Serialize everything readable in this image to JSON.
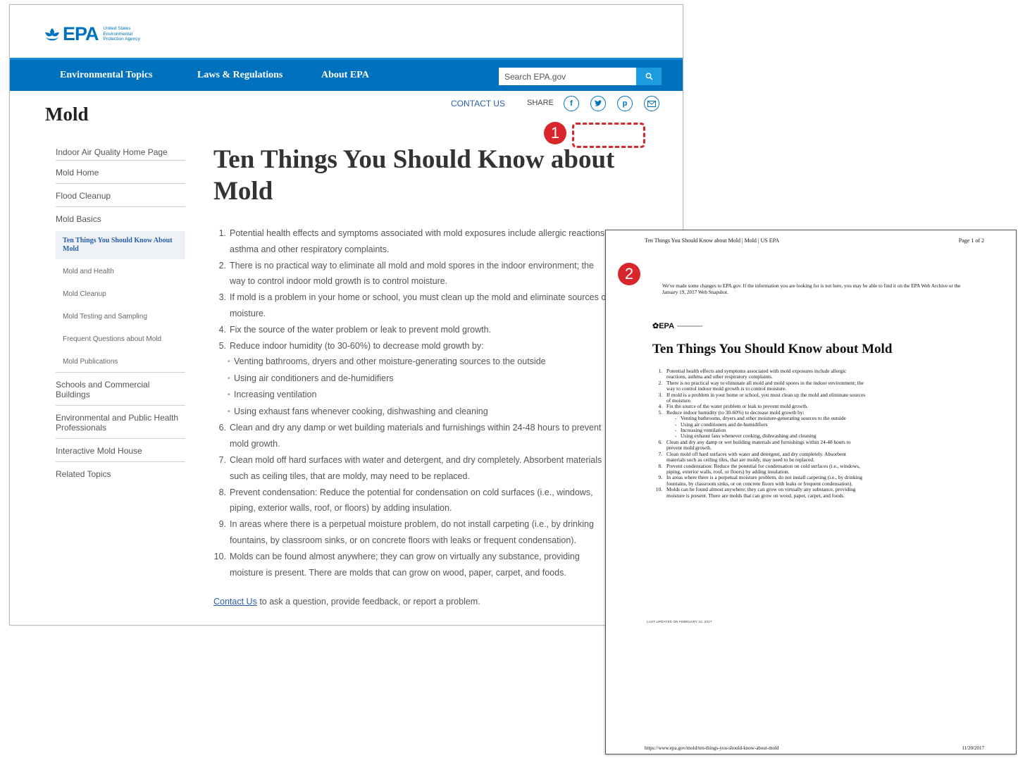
{
  "header": {
    "logo_text": "EPA",
    "agency_name": "United States Environmental Protection Agency"
  },
  "nav": {
    "items": [
      "Environmental Topics",
      "Laws & Regulations",
      "About EPA"
    ],
    "search_placeholder": "Search EPA.gov"
  },
  "utility": {
    "contact": "CONTACT US",
    "share": "SHARE"
  },
  "page_title": "Mold",
  "sidebar": {
    "items": [
      "Indoor Air Quality Home Page",
      "Mold Home",
      "Flood Cleanup",
      "Mold Basics"
    ],
    "subitems": [
      "Ten Things You Should Know About Mold",
      "Mold and Health",
      "Mold Cleanup",
      "Mold Testing and Sampling",
      "Frequent Questions about Mold",
      "Mold Publications"
    ],
    "items_after": [
      "Schools and Commercial Buildings",
      "Environmental and Public Health Professionals",
      "Interactive Mold House",
      "Related Topics"
    ]
  },
  "article": {
    "title": "Ten Things You Should Know about Mold",
    "lines": [
      {
        "n": "1.",
        "t": "Potential health effects and symptoms associated with mold exposures include allergic reactions,"
      },
      {
        "n": "",
        "t": "asthma and other respiratory complaints."
      },
      {
        "n": "2.",
        "t": "There is no practical way to eliminate all mold and mold spores in the indoor environment; the"
      },
      {
        "n": "",
        "t": "way to control indoor mold growth is to control moisture."
      },
      {
        "n": "3.",
        "t": "If mold is a problem in your home or school, you must clean up the mold and eliminate sources of"
      },
      {
        "n": "",
        "t": "moisture."
      },
      {
        "n": "4.",
        "t": "Fix the source of the water problem or leak to prevent mold growth."
      },
      {
        "n": "5.",
        "t": "Reduce indoor humidity (to 30-60%) to decrease mold growth by:"
      }
    ],
    "bullets": [
      "Venting bathrooms, dryers and other moisture-generating sources to the outside",
      "Using air conditioners and de-humidifiers",
      "Increasing ventilation",
      "Using exhaust fans whenever cooking, dishwashing and cleaning"
    ],
    "lines2": [
      {
        "n": "6.",
        "t": "Clean and dry any damp or wet building materials and furnishings within 24-48 hours to prevent"
      },
      {
        "n": "",
        "t": "mold growth."
      },
      {
        "n": "7.",
        "t": "Clean mold off hard surfaces with water and detergent, and dry completely. Absorbent materials"
      },
      {
        "n": "",
        "t": "such as ceiling tiles, that are moldy, may need to be replaced."
      },
      {
        "n": "8.",
        "t": "Prevent condensation: Reduce the potential for condensation on cold surfaces (i.e., windows,"
      },
      {
        "n": "",
        "t": "piping, exterior walls, roof, or floors) by adding insulation."
      },
      {
        "n": "9.",
        "t": "In areas where there is a perpetual moisture problem, do not install carpeting (i.e., by drinking"
      },
      {
        "n": "",
        "t": "fountains, by classroom sinks, or on concrete floors with leaks or frequent condensation)."
      },
      {
        "n": "10.",
        "t": "Molds can be found almost anywhere; they can grow on virtually any substance, providing"
      },
      {
        "n": "",
        "t": "moisture is present. There are molds that can grow on wood, paper, carpet, and foods."
      }
    ],
    "contact_link": "Contact Us",
    "contact_rest": " to ask a question, provide feedback, or report a problem."
  },
  "callouts": [
    "1",
    "2"
  ],
  "colors": {
    "epa_blue": "#0071bc",
    "callout_red": "#d9262c",
    "link_blue": "#2b5ea8"
  },
  "print": {
    "header_title": "Ten Things You Should Know about Mold | Mold | US EPA",
    "page_no": "Page 1 of 2",
    "notice": "We've made some changes to EPA.gov. If the information you are looking for is not here, you may be able to find it on the EPA Web Archive or the January 19, 2017 Web Snapshot.",
    "logo_text": "EPA",
    "title": "Ten Things You Should Know about Mold",
    "lines": [
      {
        "n": "1.",
        "t": "Potential health effects and symptoms associated with mold exposures include allergic"
      },
      {
        "n": "",
        "t": "reactions, asthma and other respiratory complaints."
      },
      {
        "n": "2.",
        "t": "There is no practical way to eliminate all mold and mold spores in the indoor environment; the"
      },
      {
        "n": "",
        "t": "way to control indoor mold growth is to control moisture."
      },
      {
        "n": "3.",
        "t": "If mold is a problem in your home or school, you must clean up the mold and eliminate sources"
      },
      {
        "n": "",
        "t": "of moisture."
      },
      {
        "n": "4.",
        "t": "Fix the source of the water problem or leak to prevent mold growth."
      },
      {
        "n": "5.",
        "t": "Reduce indoor humidity (to 30-60%) to decrease mold growth by:"
      }
    ],
    "bullets": [
      "Venting bathrooms, dryers and other moisture-generating sources to the outside",
      "Using air conditioners and de-humidifiers",
      "Increasing ventilation",
      "Using exhaust fans whenever cooking, dishwashing and cleaning"
    ],
    "lines2": [
      {
        "n": "6.",
        "t": "Clean and dry any damp or wet building materials and furnishings within 24-48 hours to"
      },
      {
        "n": "",
        "t": "prevent mold growth."
      },
      {
        "n": "7.",
        "t": "Clean mold off hard surfaces with water and detergent, and dry completely. Absorbent"
      },
      {
        "n": "",
        "t": "materials such as ceiling tiles, that are moldy, may need to be replaced."
      },
      {
        "n": "8.",
        "t": "Prevent condensation: Reduce the potential for condensation on cold surfaces (i.e., windows,"
      },
      {
        "n": "",
        "t": "piping, exterior walls, roof, or floors) by adding insulation."
      },
      {
        "n": "9.",
        "t": "In areas where there is a perpetual moisture problem, do not install carpeting (i.e., by drinking"
      },
      {
        "n": "",
        "t": "fountains, by classroom sinks, or on concrete floors with leaks or frequent condensation)."
      },
      {
        "n": "10.",
        "t": "Molds can be found almost anywhere; they can grow on virtually any substance, providing"
      },
      {
        "n": "",
        "t": "moisture is present. There are molds that can grow on wood, paper, carpet, and foods."
      }
    ],
    "last_updated": "LAST UPDATED ON FEBRUARY 22, 2017",
    "url": "https://www.epa.gov/mold/ten-things-you-should-know-about-mold",
    "date": "11/20/2017"
  }
}
